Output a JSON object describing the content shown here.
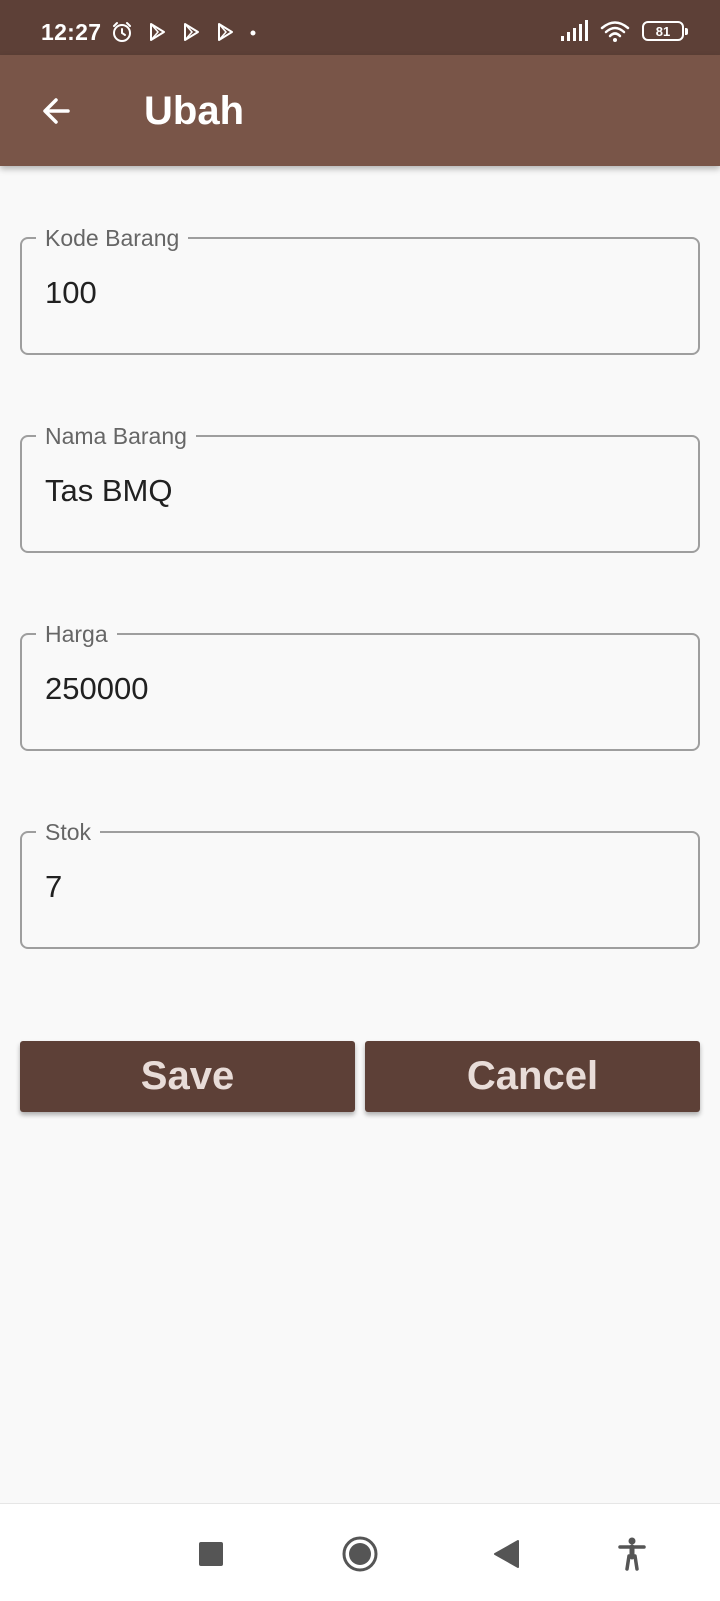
{
  "status_bar": {
    "time": "12:27",
    "battery": "81",
    "left_icons": [
      "alarm-icon",
      "play-store-icon",
      "play-store-icon",
      "play-store-icon",
      "dot-icon"
    ],
    "right_icons": [
      "signal-icon",
      "wifi-icon",
      "battery-icon"
    ]
  },
  "app_bar": {
    "title": "Ubah",
    "back_icon": "arrow-back-icon",
    "color": "#795548"
  },
  "form": {
    "fields": [
      {
        "label": "Kode Barang",
        "value": "100"
      },
      {
        "label": "Nama Barang",
        "value": "Tas BMQ"
      },
      {
        "label": "Harga",
        "value": "250000"
      },
      {
        "label": "Stok",
        "value": "7"
      }
    ]
  },
  "actions": {
    "save_label": "Save",
    "cancel_label": "Cancel",
    "color": "#5d4037"
  },
  "nav_bar": {
    "icons": [
      "recents-square-icon",
      "home-circle-icon",
      "back-triangle-icon",
      "accessibility-icon"
    ]
  }
}
